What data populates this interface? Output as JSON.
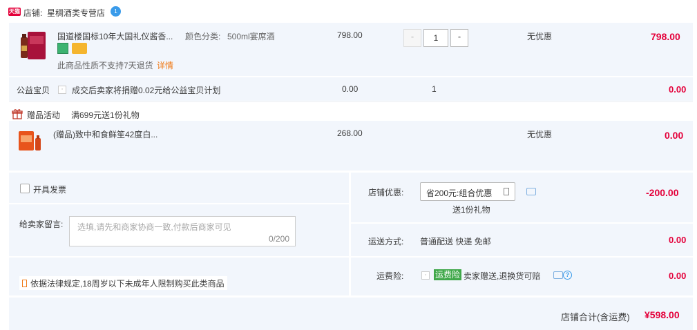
{
  "shop": {
    "store_label": "店铺:",
    "store_name": "星稠酒类专营店",
    "tmall_badge": "天猫",
    "ww_badge": "1"
  },
  "item1": {
    "title": "国道楼国标10年大国礼仪酱香...",
    "sku_label": "颜色分类:",
    "sku_value": "500ml宴席酒",
    "return_note": "此商品性质不支持7天退货",
    "detail_link": "详情",
    "price": "798.00",
    "qty": "1",
    "discount": "无优惠",
    "subtotal": "798.00"
  },
  "charity": {
    "label": "公益宝贝",
    "note": "成交后卖家将捐赠0.02元给公益宝贝计划",
    "price": "0.00",
    "qty": "1",
    "subtotal": "0.00"
  },
  "gift_activity": {
    "label": "赠品活动",
    "rule": "满699元送1份礼物"
  },
  "item2": {
    "title": "(赠品)致中和食鲜笙42度白...",
    "price": "268.00",
    "discount": "无优惠",
    "subtotal": "0.00"
  },
  "invoice": {
    "label": "开具发票"
  },
  "message": {
    "label": "给卖家留言:",
    "placeholder": "选填,请先和商家协商一致,付款后商家可见",
    "counter": "0/200"
  },
  "law_note": "依据法律规定,18周岁以下未成年人限制购买此类商品",
  "store_discount": {
    "label": "店铺优惠:",
    "selected": "省200元:组合优惠",
    "sub": "送1份礼物",
    "amount": "-200.00"
  },
  "shipping": {
    "label": "运送方式:",
    "value": "普通配送 快递 免邮",
    "amount": "0.00"
  },
  "insurance": {
    "label": "运费险:",
    "tag": "运费险",
    "value": "卖家赠送,退换货可赔",
    "amount": "0.00"
  },
  "total": {
    "label": "店铺合计(含运费)",
    "amount": "¥598.00"
  }
}
